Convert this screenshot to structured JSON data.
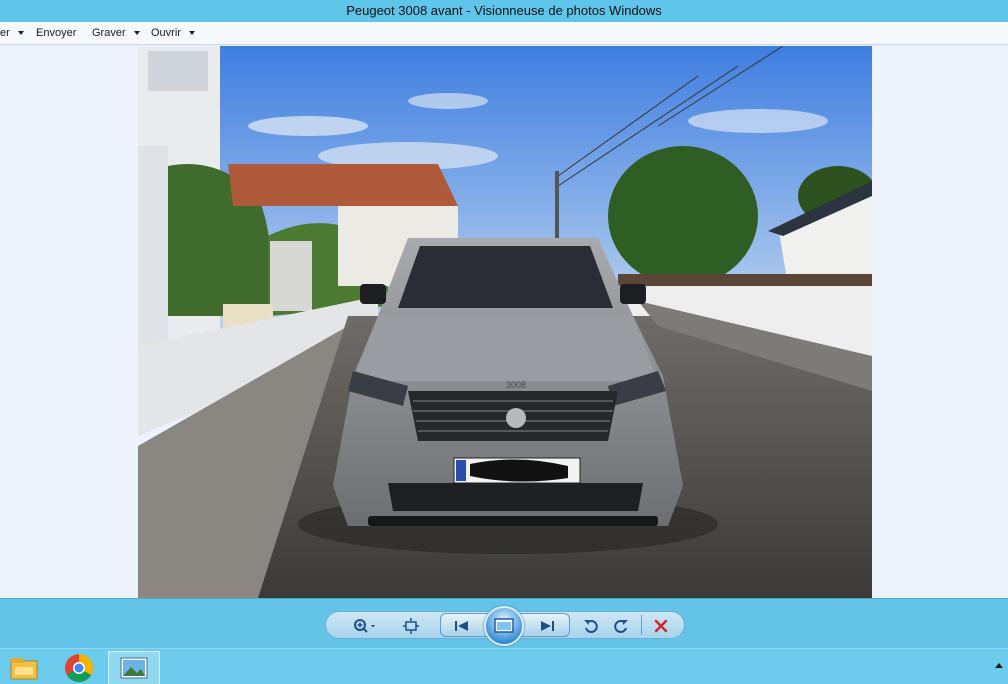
{
  "window": {
    "title": "Peugeot 3008 avant - Visionneuse de photos Windows"
  },
  "menubar": {
    "items": [
      {
        "label": "er"
      },
      {
        "label": "Envoyer"
      },
      {
        "label": "Graver"
      },
      {
        "label": "Ouvrir"
      }
    ]
  },
  "photo": {
    "subject": "peugeot-3008-front",
    "badge_text": "3008"
  },
  "controls": {
    "zoom_icon": "zoom-icon",
    "fit_icon": "actual-size-icon",
    "prev_icon": "previous-icon",
    "slideshow_icon": "slideshow-icon",
    "next_icon": "next-icon",
    "rotate_ccw_icon": "rotate-counterclockwise-icon",
    "rotate_cw_icon": "rotate-clockwise-icon",
    "delete_icon": "delete-icon",
    "accent": "#1d6fc0",
    "delete_color": "#d2232a"
  },
  "taskbar": {
    "apps": [
      "file-explorer-icon",
      "chrome-icon",
      "photo-viewer-icon"
    ]
  }
}
